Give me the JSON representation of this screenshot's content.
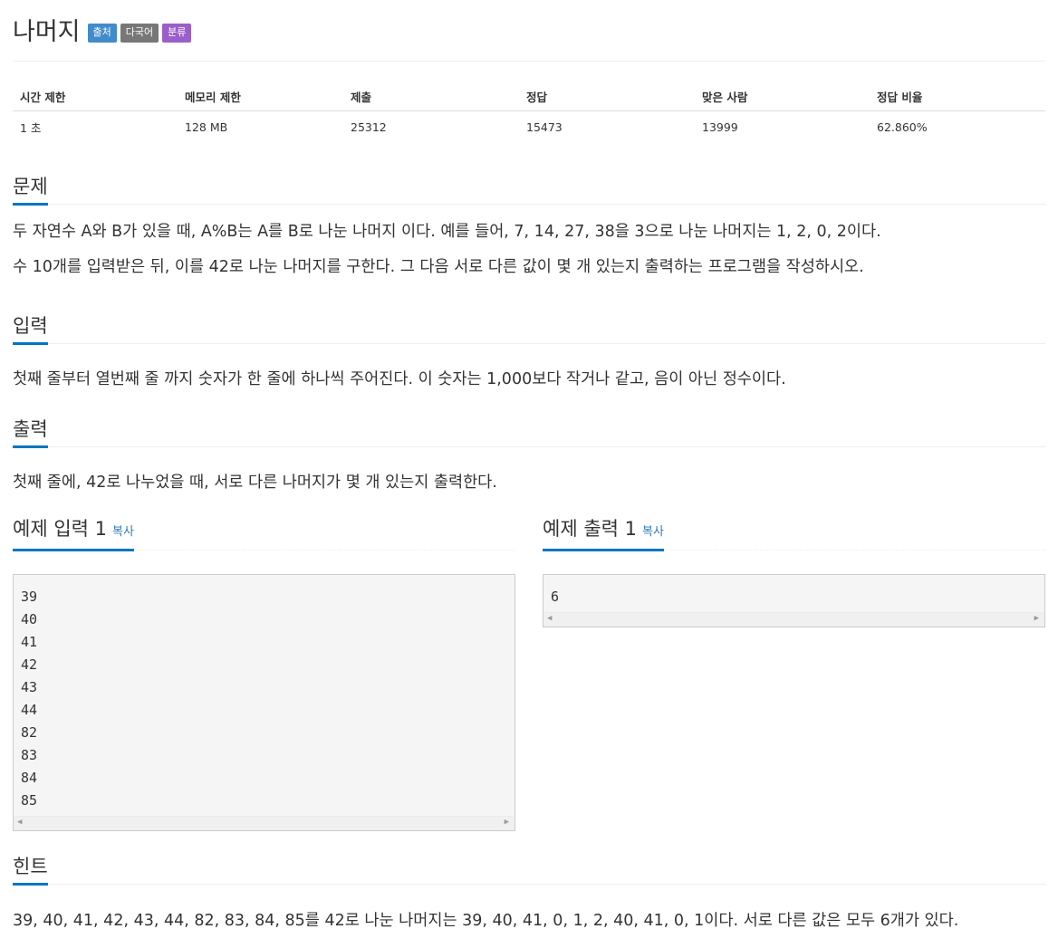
{
  "problem": {
    "title": "나머지",
    "badges": [
      "출처",
      "다국어",
      "분류"
    ]
  },
  "info_table": {
    "headers": [
      "시간 제한",
      "메모리 제한",
      "제출",
      "정답",
      "맞은 사람",
      "정답 비율"
    ],
    "values": [
      "1 초",
      "128 MB",
      "25312",
      "15473",
      "13999",
      "62.860%"
    ]
  },
  "sections": {
    "description": {
      "title": "문제",
      "paragraphs": [
        "두 자연수 A와 B가 있을 때, A%B는 A를 B로 나눈 나머지 이다. 예를 들어, 7, 14, 27, 38을 3으로 나눈 나머지는 1, 2, 0, 2이다.",
        "수 10개를 입력받은 뒤, 이를 42로 나눈 나머지를 구한다. 그 다음 서로 다른 값이 몇 개 있는지 출력하는 프로그램을 작성하시오."
      ]
    },
    "input": {
      "title": "입력",
      "text": "첫째 줄부터 열번째 줄 까지 숫자가 한 줄에 하나씩 주어진다. 이 숫자는 1,000보다 작거나 같고, 음이 아닌 정수이다."
    },
    "output": {
      "title": "출력",
      "text": "첫째 줄에, 42로 나누었을 때, 서로 다른 나머지가 몇 개 있는지 출력한다."
    },
    "hint": {
      "title": "힌트",
      "text": "39, 40, 41, 42, 43, 44, 82, 83, 84, 85를 42로 나눈 나머지는 39, 40, 41, 0, 1, 2, 40, 41, 0, 1이다. 서로 다른 값은 모두 6개가 있다."
    }
  },
  "samples": {
    "copy_label": "복사",
    "input": {
      "title": "예제 입력 1",
      "lines": [
        "39",
        "40",
        "41",
        "42",
        "43",
        "44",
        "82",
        "83",
        "84",
        "85"
      ]
    },
    "output": {
      "title": "예제 출력 1",
      "lines": [
        "6"
      ]
    }
  },
  "icons": {
    "scroll_left": "scroll-left-arrow-icon",
    "scroll_right": "scroll-right-arrow-icon"
  },
  "colors": {
    "accent_underline": "#0076c0",
    "badge_source": "#428bca",
    "badge_language": "#777777",
    "badge_category": "#9b5fc9",
    "link": "#337ab7"
  }
}
